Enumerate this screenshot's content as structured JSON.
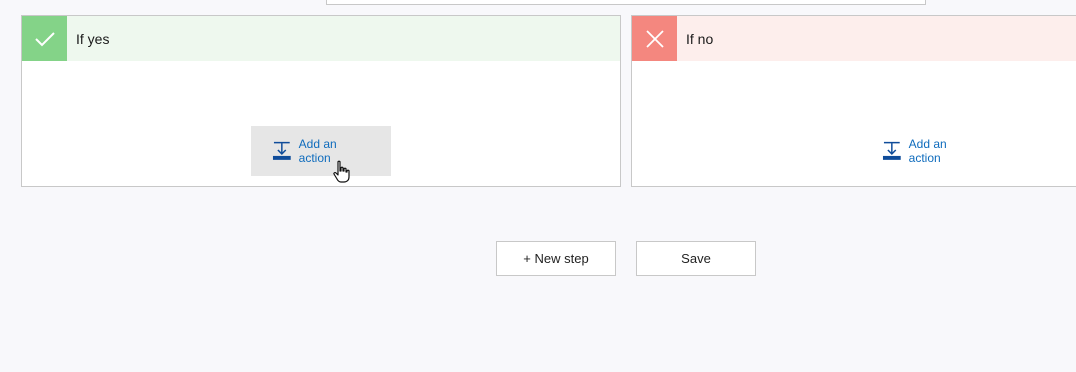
{
  "condition": {
    "yes_branch": {
      "title": "If yes",
      "add_action_label": "Add an action",
      "color": "#84d388"
    },
    "no_branch": {
      "title": "If no",
      "add_action_label": "Add an action",
      "color": "#f4877f"
    }
  },
  "footer": {
    "new_step_label": "+ New step",
    "save_label": "Save"
  },
  "icons": [
    "checkmark-icon",
    "close-icon",
    "add-action-icon",
    "hand-cursor-icon"
  ]
}
